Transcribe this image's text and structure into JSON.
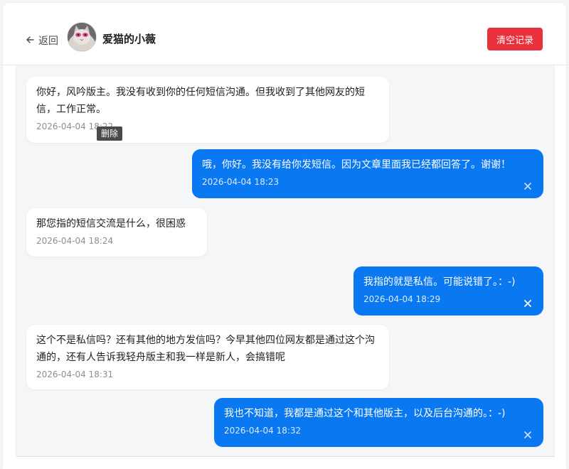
{
  "header": {
    "back_label": "返回",
    "contact_name": "爱猫的小薇",
    "clear_button_label": "清空记录"
  },
  "tooltip": {
    "label": "删除"
  },
  "messages": [
    {
      "direction": "incoming",
      "text": "你好，风吟版主。我没有收到你的任何短信沟通。但我收到了其他网友的短信，工作正常。",
      "time": "2026-04-04 18:22"
    },
    {
      "direction": "outgoing",
      "text": "哦，你好。我没有给你发短信。因为文章里面我已经都回答了。谢谢！",
      "time": "2026-04-04 18:23"
    },
    {
      "direction": "incoming",
      "text": "那您指的短信交流是什么，很困惑",
      "time": "2026-04-04 18:24"
    },
    {
      "direction": "outgoing",
      "text": "我指的就是私信。可能说错了。：-)",
      "time": "2026-04-04 18:29"
    },
    {
      "direction": "incoming",
      "text": "这个不是私信吗？还有其他的地方发信吗？今早其他四位网友都是通过这个沟通的，还有人告诉我轻舟版主和我一样是新人，会搞错呢",
      "time": "2026-04-04 18:31"
    },
    {
      "direction": "outgoing",
      "text": "我也不知道，我都是通过这个和其他版主，以及后台沟通的。：-)",
      "time": "2026-04-04 18:32"
    }
  ],
  "colors": {
    "accent_blue": "#0a78f0",
    "danger_red": "#e8313d",
    "chat_bg": "#f5f6f8"
  },
  "icons": {
    "back": "arrow-left-icon",
    "delete": "close-icon",
    "avatar": "cat-avatar-image"
  }
}
